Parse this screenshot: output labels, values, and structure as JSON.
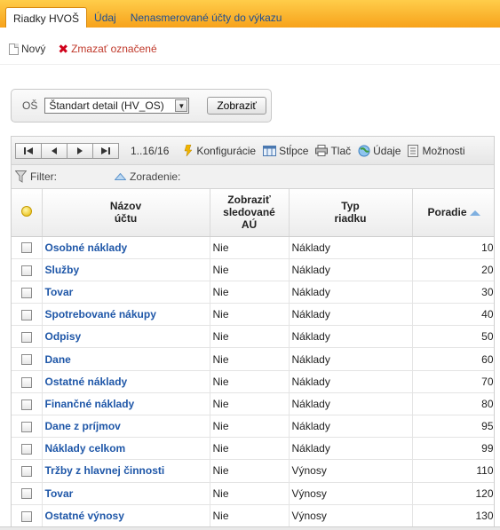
{
  "tabs": [
    {
      "label": "Riadky HVOŠ",
      "active": true
    },
    {
      "label": "Údaj",
      "active": false
    },
    {
      "label": "Nenasmerované účty do výkazu",
      "active": false
    }
  ],
  "actions": {
    "new_label": "Nový",
    "delete_label": "Zmazať označené"
  },
  "filter": {
    "os_label": "OŠ",
    "os_selected": "Štandart detail (HV_OS)",
    "show_button": "Zobraziť"
  },
  "toolbar": {
    "count": "1..16/16",
    "config": "Konfigurácie",
    "columns": "Stĺpce",
    "print": "Tlač",
    "data": "Údaje",
    "options": "Možnosti"
  },
  "filterbar": {
    "filter_label": "Filter:",
    "sort_label": "Zoradenie:"
  },
  "columns": {
    "name": "Názov\núčtu",
    "show_tracked": "Zobraziť\nsledované\nAÚ",
    "row_type": "Typ\nriadku",
    "order": "Poradie"
  },
  "rows": [
    {
      "name": "Osobné náklady",
      "tracked": "Nie",
      "type": "Náklady",
      "order": "10"
    },
    {
      "name": "Služby",
      "tracked": "Nie",
      "type": "Náklady",
      "order": "20"
    },
    {
      "name": "Tovar",
      "tracked": "Nie",
      "type": "Náklady",
      "order": "30"
    },
    {
      "name": "Spotrebované nákupy",
      "tracked": "Nie",
      "type": "Náklady",
      "order": "40"
    },
    {
      "name": "Odpisy",
      "tracked": "Nie",
      "type": "Náklady",
      "order": "50"
    },
    {
      "name": "Dane",
      "tracked": "Nie",
      "type": "Náklady",
      "order": "60"
    },
    {
      "name": "Ostatné náklady",
      "tracked": "Nie",
      "type": "Náklady",
      "order": "70"
    },
    {
      "name": "Finančné náklady",
      "tracked": "Nie",
      "type": "Náklady",
      "order": "80"
    },
    {
      "name": "Dane z príjmov",
      "tracked": "Nie",
      "type": "Náklady",
      "order": "95"
    },
    {
      "name": "Náklady celkom",
      "tracked": "Nie",
      "type": "Náklady",
      "order": "99"
    },
    {
      "name": "Tržby z hlavnej činnosti",
      "tracked": "Nie",
      "type": "Výnosy",
      "order": "110"
    },
    {
      "name": "Tovar",
      "tracked": "Nie",
      "type": "Výnosy",
      "order": "120"
    },
    {
      "name": "Ostatné výnosy",
      "tracked": "Nie",
      "type": "Výnosy",
      "order": "130"
    }
  ]
}
